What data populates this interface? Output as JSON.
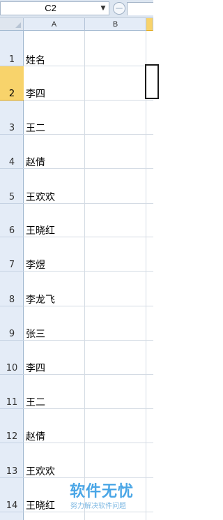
{
  "name_box": {
    "value": "C2",
    "dropdown_icon": "chevron-down-icon"
  },
  "columns": [
    "A",
    "B"
  ],
  "selected_column": "C",
  "rows": [
    {
      "num": "1",
      "a": "姓名"
    },
    {
      "num": "2",
      "a": "李四"
    },
    {
      "num": "3",
      "a": "王二"
    },
    {
      "num": "4",
      "a": "赵倩"
    },
    {
      "num": "5",
      "a": "王欢欢"
    },
    {
      "num": "6",
      "a": "王晓红"
    },
    {
      "num": "7",
      "a": "李煜"
    },
    {
      "num": "8",
      "a": "李龙飞"
    },
    {
      "num": "9",
      "a": "张三"
    },
    {
      "num": "10",
      "a": "李四"
    },
    {
      "num": "11",
      "a": "王二"
    },
    {
      "num": "12",
      "a": "赵倩"
    },
    {
      "num": "13",
      "a": "王欢欢"
    },
    {
      "num": "14",
      "a": "王晓红"
    }
  ],
  "watermark": {
    "title": "软件无忧",
    "subtitle": "努力解决软件问题"
  },
  "colors": {
    "selected_header": "#f8d36b",
    "header_bg": "#e4ecf7",
    "watermark": "#4aa6e6"
  }
}
